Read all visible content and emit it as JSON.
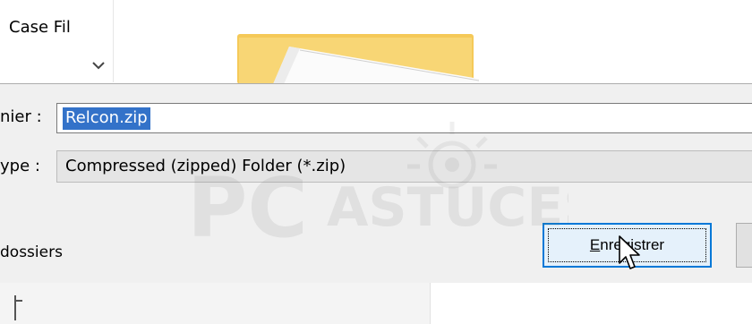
{
  "navigation": {
    "folder_label": "Case Fil"
  },
  "dialog": {
    "filename_label": "nier :",
    "filename_value": "Relcon.zip",
    "filetype_label": "ype :",
    "filetype_value": "Compressed (zipped) Folder (*.zip)",
    "hide_folders_label": "dossiers",
    "save_button": {
      "accel": "E",
      "rest": "nregistrer"
    }
  },
  "watermark": {
    "brand_prefix": "PC",
    "brand_suffix": "ASTUCES"
  },
  "colors": {
    "selection": "#3372c9",
    "focus_border": "#0078d7",
    "dialog_bg": "#f0f0f0"
  }
}
